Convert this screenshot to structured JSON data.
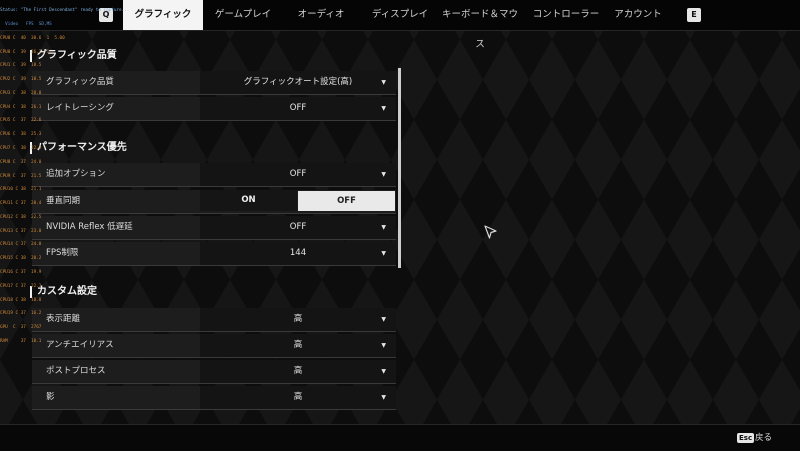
{
  "overlay": {
    "status": "Status: \"The First Descendant\" ready to capture...",
    "header": "  Video   FPS  SD,MS",
    "lines": [
      "CPU0 C  40  30.6  1  5.00",
      "CPU0 C  39  26.2  1",
      "CPU1 C  39  18.5",
      "CPU2 C  39  18.5",
      "CPU3 C  38  28.0",
      "CPU4 C  38  26.1",
      "CPU5 C  37  22.6",
      "CPU6 C  38  25.3",
      "CPU7 C  38  22.9",
      "CPU8 C  37  24.0",
      "CPU9 C  37  21.5",
      "CPU10 C 38  21.1",
      "CPU11 C 37  20.4",
      "CPU12 C 38  22.5",
      "CPU13 C 37  23.0",
      "CPU14 C 37  24.8",
      "CPU15 C 38  20.2",
      "CPU16 C 37  19.9",
      "CPU17 C 37  22.1",
      "CPU18 C 38  18.8",
      "CPU19 C 37  16.2",
      "GPU  C  37  2767",
      "RAM     37  10.1"
    ]
  },
  "topbar": {
    "left_key": "Q",
    "right_key": "E",
    "tabs": [
      {
        "label": "グラフィック",
        "active": true
      },
      {
        "label": "ゲームプレイ",
        "active": false
      },
      {
        "label": "オーディオ",
        "active": false
      },
      {
        "label": "ディスプレイ",
        "active": false
      },
      {
        "label": "キーボード＆マウス",
        "active": false
      },
      {
        "label": "コントローラー",
        "active": false
      },
      {
        "label": "アカウント",
        "active": false
      }
    ]
  },
  "sections": {
    "graphics_quality": {
      "title": "グラフィック品質",
      "rows": [
        {
          "label": "グラフィック品質",
          "value": "グラフィックオート設定(高)"
        },
        {
          "label": "レイトレーシング",
          "value": "OFF"
        }
      ]
    },
    "performance": {
      "title": "パフォーマンス優先",
      "rows": [
        {
          "label": "追加オプション",
          "value": "OFF"
        },
        {
          "label": "垂直同期",
          "on_label": "ON",
          "off_label": "OFF",
          "selected": "OFF"
        },
        {
          "label": "NVIDIA Reflex 低遅延",
          "value": "OFF"
        },
        {
          "label": "FPS制限",
          "value": "144"
        }
      ]
    },
    "custom": {
      "title": "カスタム設定",
      "rows": [
        {
          "label": "表示距離",
          "value": "高"
        },
        {
          "label": "アンチエイリアス",
          "value": "高"
        },
        {
          "label": "ポストプロセス",
          "value": "高"
        },
        {
          "label": "影",
          "value": "高"
        }
      ]
    }
  },
  "dropdown_arrow": "▼",
  "bottombar": {
    "esc_key": "Esc",
    "esc_label": "戻る"
  },
  "colors": {
    "active_tab_bg": "#f4f4f4",
    "background": "#121212",
    "toggle_selected": "#e9e9e9"
  }
}
